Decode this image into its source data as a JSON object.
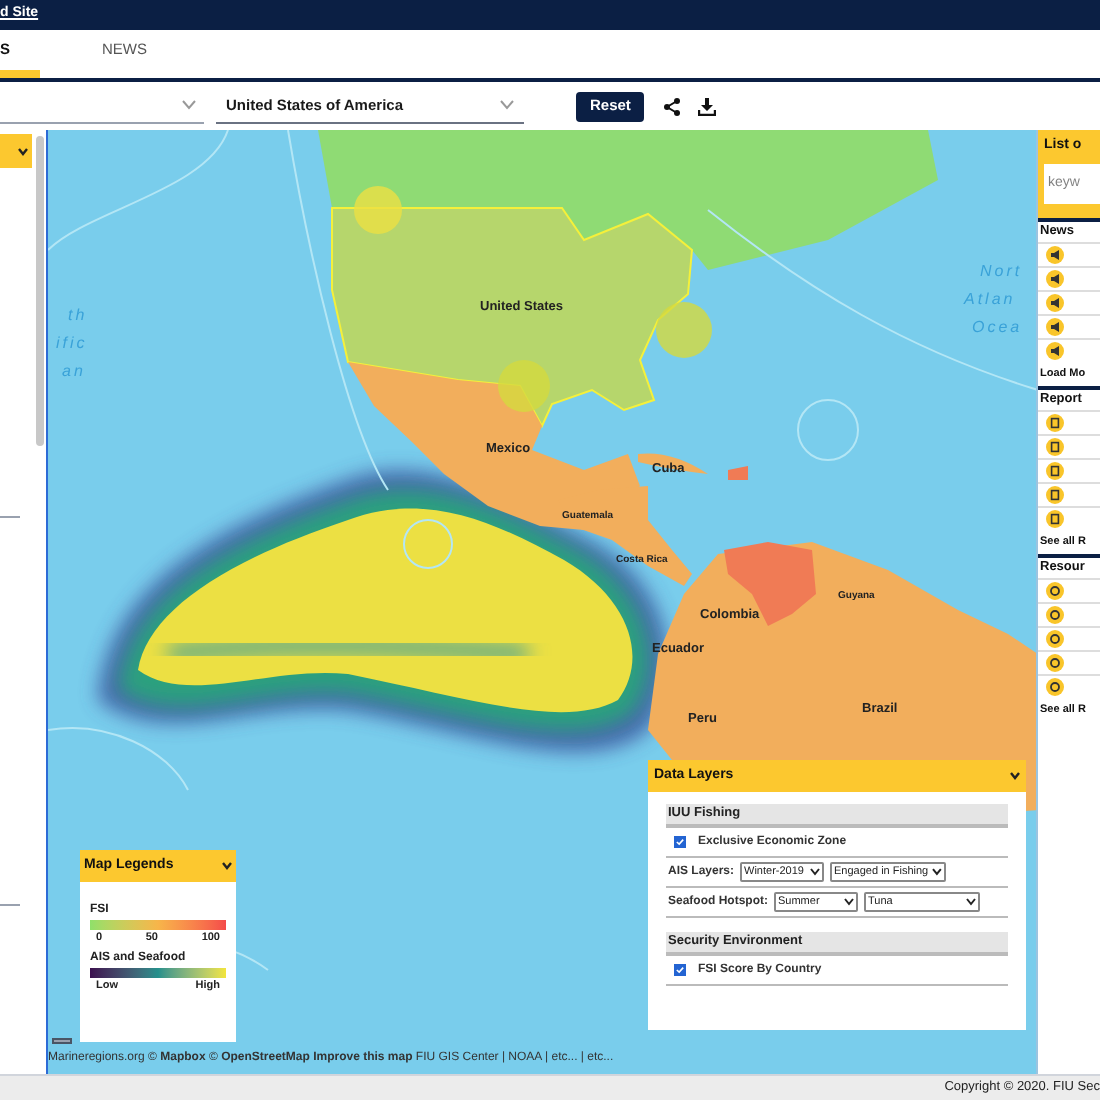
{
  "top_bar": {
    "link": "d Site"
  },
  "tabs": [
    {
      "label": "S",
      "selected": true
    },
    {
      "label": "NEWS",
      "selected": false
    }
  ],
  "filters": {
    "country": "United States of America",
    "reset": "Reset"
  },
  "map_labels": [
    {
      "text": "United States",
      "kind": "country"
    },
    {
      "text": "Mexico",
      "kind": "country"
    },
    {
      "text": "Cuba",
      "kind": "country"
    },
    {
      "text": "Guatemala",
      "kind": "small"
    },
    {
      "text": "Costa Rica",
      "kind": "small"
    },
    {
      "text": "Colombia",
      "kind": "country"
    },
    {
      "text": "Ecuador",
      "kind": "country"
    },
    {
      "text": "Guyana",
      "kind": "small"
    },
    {
      "text": "Peru",
      "kind": "country"
    },
    {
      "text": "Brazil",
      "kind": "country"
    },
    {
      "text": "th",
      "kind": "ocean"
    },
    {
      "text": "ific",
      "kind": "ocean"
    },
    {
      "text": "an",
      "kind": "ocean"
    },
    {
      "text": "Nort",
      "kind": "ocean"
    },
    {
      "text": "Atlan",
      "kind": "ocean"
    },
    {
      "text": "Ocea",
      "kind": "ocean"
    }
  ],
  "map_legends": {
    "title": "Map Legends",
    "sections": [
      {
        "title": "FSI",
        "kind": "fsi",
        "ticks": [
          "0",
          "50",
          "100"
        ]
      },
      {
        "title": "AIS and Seafood",
        "kind": "ais",
        "ticks": [
          "Low",
          "High"
        ]
      }
    ]
  },
  "data_layers": {
    "title": "Data Layers",
    "groups": [
      {
        "title": "IUU Fishing",
        "rows": [
          {
            "kind": "checkbox",
            "label": "Exclusive Economic Zone",
            "checked": true
          },
          {
            "kind": "selects",
            "label": "AIS Layers:",
            "values": [
              "Winter-2019",
              "Engaged in Fishing"
            ]
          },
          {
            "kind": "selects",
            "label": "Seafood Hotspot:",
            "values": [
              "Summer",
              "Tuna"
            ]
          }
        ]
      },
      {
        "title": "Security Environment",
        "rows": [
          {
            "kind": "checkbox",
            "label": "FSI Score By Country",
            "checked": true
          }
        ]
      }
    ]
  },
  "attribution": "Marineregions.org © **Mapbox** © **OpenStreetMap** **Improve this map** FIU GIS Center | NOAA | etc... | etc...",
  "right_panel": {
    "title": "List o",
    "search_placeholder": "keyw",
    "sections": [
      {
        "title": "News",
        "kind": "news",
        "more": "Load Mo"
      },
      {
        "title": "Report",
        "kind": "report",
        "more": "See all R"
      },
      {
        "title": "Resour",
        "kind": "resource",
        "more": "See all R"
      }
    ]
  },
  "footer": "Copyright © 2020. FIU Sec"
}
